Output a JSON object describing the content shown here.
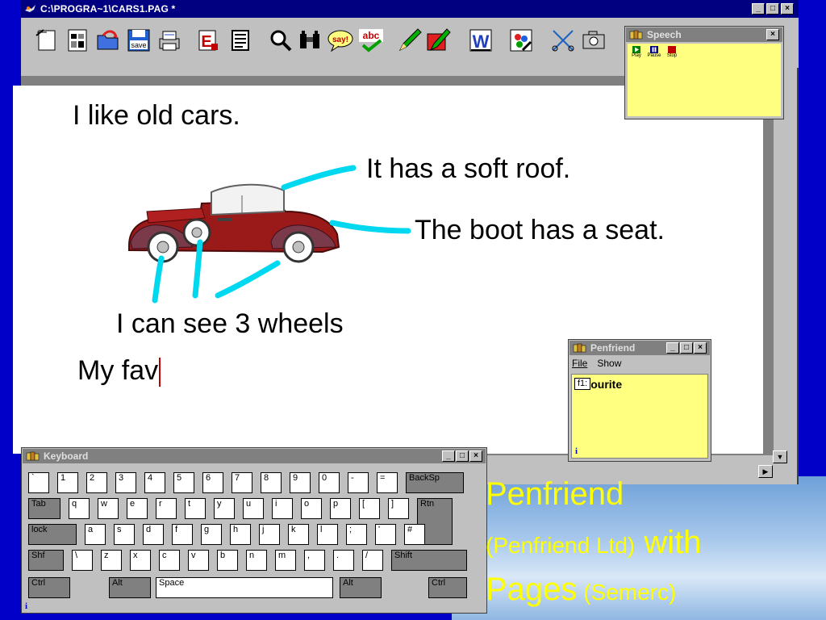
{
  "window": {
    "title": "C:\\PROGRA~1\\CARS1.PAG *",
    "min_glyph": "_",
    "max_glyph": "□",
    "close_glyph": "×"
  },
  "toolbar": {
    "tools": [
      {
        "id": "new-page",
        "icon": "new-page-icon"
      },
      {
        "id": "file-list",
        "icon": "file-list-icon"
      },
      {
        "id": "open",
        "icon": "open-folder-icon"
      },
      {
        "id": "save",
        "icon": "save-icon",
        "label": "save"
      },
      {
        "id": "print",
        "icon": "printer-icon"
      },
      {
        "id": "eraser",
        "icon": "eraser-icon",
        "label": "E"
      },
      {
        "id": "text-list",
        "icon": "text-list-icon"
      },
      {
        "id": "find",
        "icon": "magnifier-icon"
      },
      {
        "id": "binoculars",
        "icon": "binoculars-icon"
      },
      {
        "id": "say",
        "icon": "say-bubble-icon",
        "label": "say!"
      },
      {
        "id": "spell",
        "icon": "spellcheck-icon",
        "label": "abc"
      },
      {
        "id": "pen",
        "icon": "pen-icon"
      },
      {
        "id": "color-pen",
        "icon": "color-pen-icon"
      },
      {
        "id": "word",
        "icon": "word-icon",
        "label": "W"
      },
      {
        "id": "paint",
        "icon": "paint-icon"
      },
      {
        "id": "scissors",
        "icon": "scissors-icon"
      },
      {
        "id": "camera",
        "icon": "camera-icon"
      }
    ]
  },
  "document": {
    "line1": "I like old cars.",
    "label_roof": "It has a soft roof.",
    "label_boot": "The boot has a seat.",
    "label_wheels": "I can see 3 wheels",
    "line_typing": "My fav"
  },
  "speech_panel": {
    "title": "Speech",
    "close_glyph": "×",
    "buttons": [
      {
        "label": "Play",
        "color": "#008000"
      },
      {
        "label": "Pause",
        "color": "#000080"
      },
      {
        "label": "Stop",
        "color": "#c00000"
      }
    ]
  },
  "penfriend_panel": {
    "title": "Penfriend",
    "menu_file": "File",
    "menu_show": "Show",
    "prediction_key": "f1:",
    "prediction_word": "favourite",
    "info_glyph": "i"
  },
  "keyboard_panel": {
    "title": "Keyboard",
    "info_glyph": "i",
    "rows": [
      [
        "`",
        "1",
        "2",
        "3",
        "4",
        "5",
        "6",
        "7",
        "8",
        "9",
        "0",
        "-",
        "=",
        "BackSp"
      ],
      [
        "Tab",
        "q",
        "w",
        "e",
        "r",
        "t",
        "y",
        "u",
        "i",
        "o",
        "p",
        "[",
        "]",
        "Rtn"
      ],
      [
        "lock",
        "a",
        "s",
        "d",
        "f",
        "g",
        "h",
        "j",
        "k",
        "l",
        ";",
        "'",
        "#"
      ],
      [
        "Shf",
        "\\",
        "z",
        "x",
        "c",
        "v",
        "b",
        "n",
        "m",
        ",",
        ".",
        "/",
        "Shift"
      ],
      [
        "Ctrl",
        "Alt",
        "Space",
        "Alt",
        "Ctrl"
      ]
    ]
  },
  "caption": {
    "line1": "Penfriend",
    "line2_small": "(Penfriend Ltd)",
    "line2_big": " with",
    "line3_big": "Pages",
    "line3_small": " (Semerc)"
  },
  "colors": {
    "slide_bg": "#0000c8",
    "caption": "#ffff00",
    "annotation_line": "#00d8f0",
    "panel_yellow": "#ffff80",
    "title_bar": "#000080"
  }
}
